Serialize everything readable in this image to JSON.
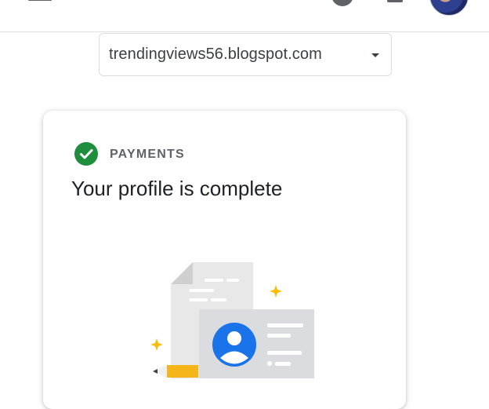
{
  "header": {
    "menu_icon": "menu-icon",
    "help_icon": "help-icon",
    "notifications_icon": "bell-icon",
    "avatar": "user-avatar"
  },
  "site_selector": {
    "value": "trendingviews56.blogspot.com",
    "icon": "arrow-drop-down-icon"
  },
  "card": {
    "section_label": "PAYMENTS",
    "title": "Your profile is complete",
    "status_icon": "check-circle-icon",
    "colors": {
      "check": "#1e8e3e",
      "sparkle": "#fbbc04",
      "profile_blue": "#1a73e8"
    }
  }
}
